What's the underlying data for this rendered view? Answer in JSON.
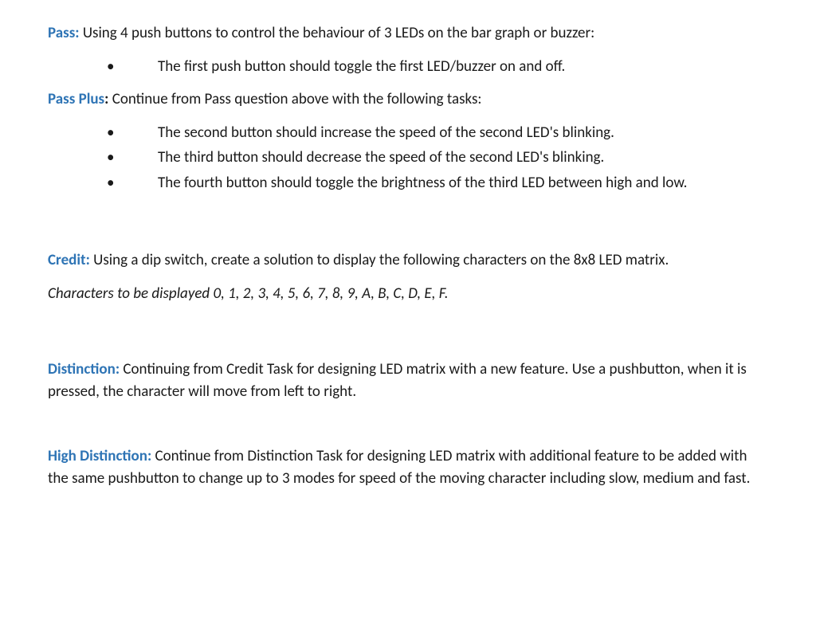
{
  "pass": {
    "label": "Pass:",
    "text": " Using 4 push buttons to control the behaviour of 3 LEDs on the bar graph or buzzer:",
    "bullets": [
      "The first push button should toggle the first LED/buzzer on and off."
    ]
  },
  "passplus": {
    "label": "Pass Plus",
    "colon": ": ",
    "text": "Continue from Pass question above with the following tasks:",
    "bullets": [
      "The second button should increase the speed of the second LED's blinking.",
      "The third button should decrease the speed of the second LED's blinking.",
      "The fourth button should toggle the brightness of the third LED between high and low."
    ]
  },
  "credit": {
    "label": "Credit:",
    "text": " Using a dip switch, create a solution to display the following characters on the 8x8 LED matrix.",
    "italic_text": "Characters to be displayed 0, 1, 2, 3, 4, 5, 6, 7, 8, 9, A, B, C, D, E, F."
  },
  "distinction": {
    "label": "Distinction:",
    "text": " Continuing from Credit Task for designing LED matrix with a new feature. Use a pushbutton, when it is pressed, the character will move from left to right."
  },
  "high_distinction": {
    "label": "High Distinction:",
    "text": " Continue from Distinction Task for designing LED matrix with additional feature to be added with the same pushbutton to change up to 3 modes for speed of the moving character including slow, medium and fast."
  }
}
